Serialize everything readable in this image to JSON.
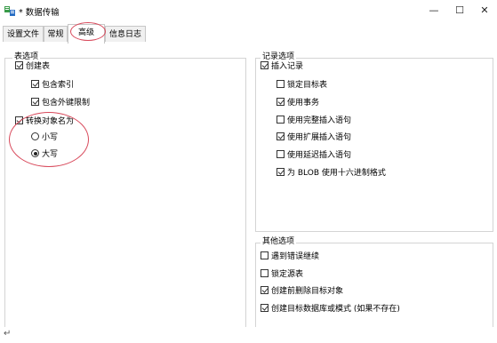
{
  "window": {
    "title": "* 数据传输",
    "controls": {
      "minimize": "—",
      "maximize": "☐",
      "close": "✕"
    }
  },
  "tabs": [
    {
      "label": "设置文件",
      "active": false
    },
    {
      "label": "常规",
      "active": false
    },
    {
      "label": "高级",
      "active": true
    },
    {
      "label": "信息日志",
      "active": false
    }
  ],
  "table_options": {
    "title": "表选项",
    "create_table": {
      "label": "创建表",
      "checked": true
    },
    "include_index": {
      "label": "包含索引",
      "checked": true
    },
    "include_fk": {
      "label": "包含外键限制",
      "checked": true
    },
    "convert_name": {
      "label": "转换对象名为",
      "checked": true
    },
    "lowercase": {
      "label": "小写",
      "selected": false
    },
    "uppercase": {
      "label": "大写",
      "selected": true
    }
  },
  "record_options": {
    "title": "记录选项",
    "insert_records": {
      "label": "插入记录",
      "checked": true
    },
    "lock_target": {
      "label": "锁定目标表",
      "checked": false
    },
    "use_transaction": {
      "label": "使用事务",
      "checked": true
    },
    "complete_insert": {
      "label": "使用完整插入语句",
      "checked": false
    },
    "extended_insert": {
      "label": "使用扩展插入语句",
      "checked": true
    },
    "delayed_insert": {
      "label": "使用延迟插入语句",
      "checked": false
    },
    "blob_hex": {
      "label": "为 BLOB 使用十六进制格式",
      "checked": true
    }
  },
  "other_options": {
    "title": "其他选项",
    "continue_on_error": {
      "label": "遇到错误继续",
      "checked": false
    },
    "lock_source": {
      "label": "锁定源表",
      "checked": false
    },
    "drop_before_create": {
      "label": "创建前删除目标对象",
      "checked": true
    },
    "create_db": {
      "label": "创建目标数据库或模式 (如果不存在)",
      "checked": true
    }
  },
  "footer": {
    "mark": "↵"
  },
  "colors": {
    "highlight": "#d8485a",
    "border": "#d4d4d4"
  },
  "icons": {
    "app": "data-transfer-icon"
  }
}
